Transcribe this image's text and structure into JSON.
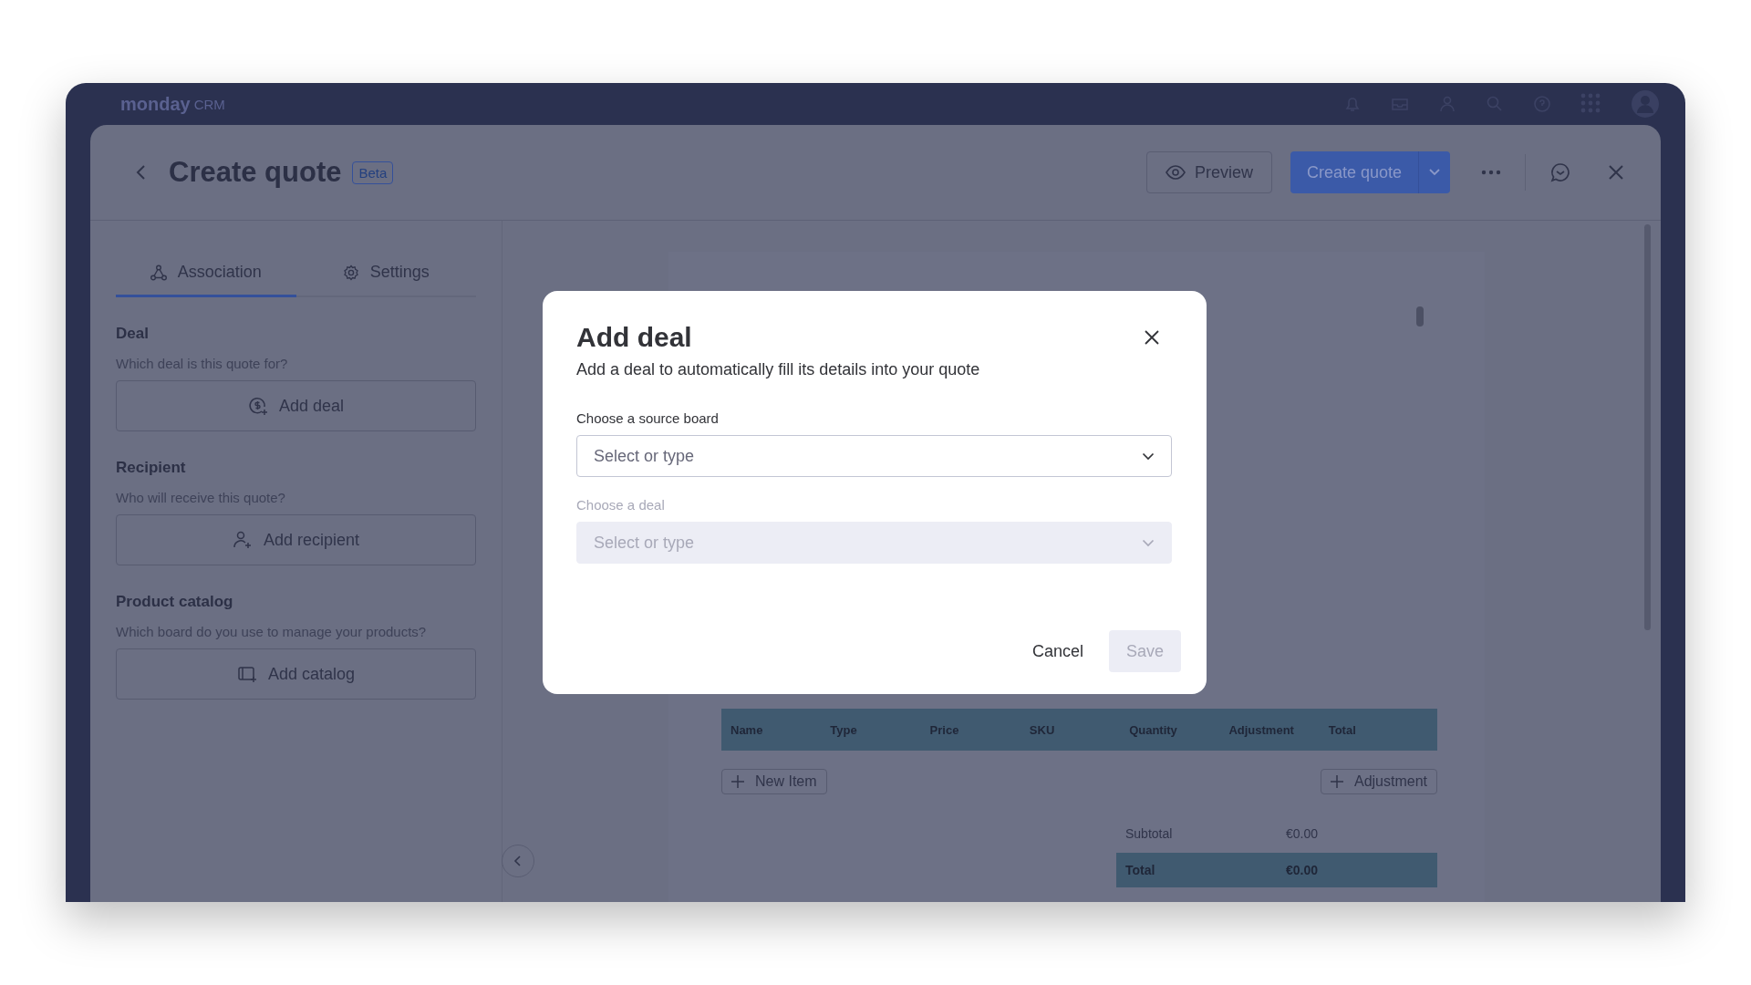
{
  "app_bar": {
    "logo": "monday",
    "product": "CRM"
  },
  "header": {
    "title": "Create quote",
    "badge": "Beta",
    "preview_button": "Preview",
    "create_button": "Create quote"
  },
  "tabs": [
    {
      "label": "Association",
      "selected": true,
      "kind": "association"
    },
    {
      "label": "Settings",
      "selected": false,
      "kind": "settings"
    }
  ],
  "sections": [
    {
      "title": "Deal",
      "question": "Which deal is this quote for?",
      "button": "Add deal",
      "kind": "deal"
    },
    {
      "title": "Recipient",
      "question": "Who will receive this quote?",
      "button": "Add recipient",
      "kind": "recipient"
    },
    {
      "title": "Product catalog",
      "question": "Which board do you use to manage your products?",
      "button": "Add catalog",
      "kind": "catalog"
    }
  ],
  "quote_preview": {
    "columns": [
      "Name",
      "Type",
      "Price",
      "SKU",
      "Quantity",
      "Adjustment",
      "Total"
    ],
    "new_item_button": "New Item",
    "adjustment_button": "Adjustment",
    "subtotal_label": "Subtotal",
    "subtotal": "€0.00",
    "total_label": "Total",
    "total": "€0.00"
  },
  "modal": {
    "title": "Add deal",
    "subtitle": "Add a deal to automatically fill its details into your quote",
    "fields": [
      {
        "label": "Choose a source board",
        "placeholder": "Select or type",
        "disabled": false
      },
      {
        "label": "Choose a deal",
        "placeholder": "Select or type",
        "disabled": true
      }
    ],
    "cancel_button": "Cancel",
    "save_button": "Save",
    "save_disabled": true
  }
}
